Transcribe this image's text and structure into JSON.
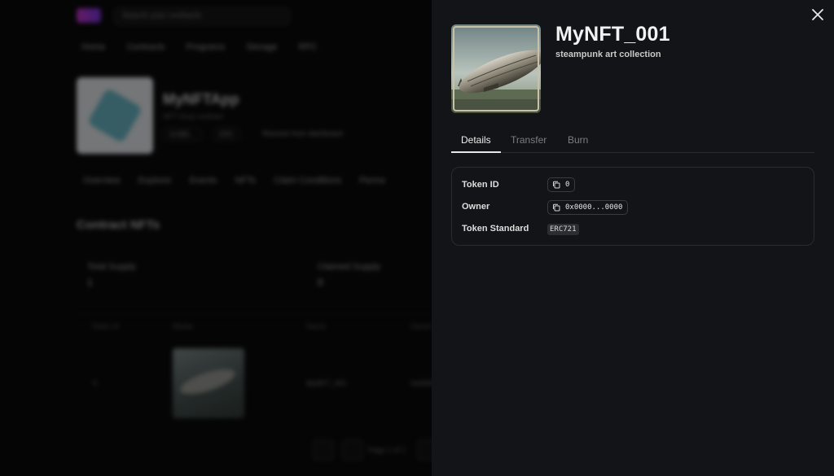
{
  "background": {
    "search_placeholder": "Search your contracts",
    "nav": [
      "Home",
      "Contracts",
      "Programs",
      "Storage",
      "RPC"
    ],
    "app_name": "MyNFTApp",
    "app_subtitle": "NFT Drop contract",
    "chips": [
      "0x0B5...",
      "ERC"
    ],
    "chip_import": "Remove from dashboard",
    "tabs": [
      "Overview",
      "Explorer",
      "Events",
      "NFTs",
      "Claim Conditions",
      "Perms"
    ],
    "section_title": "Contract NFTs",
    "stats": [
      {
        "label": "Total Supply",
        "value": "1"
      },
      {
        "label": "Claimed Supply",
        "value": "0"
      }
    ],
    "columns": [
      "Token Id",
      "Media",
      "Name",
      "Owner"
    ],
    "row": {
      "token_id": "0",
      "name": "MyNFT_001",
      "owner": "0x0000"
    },
    "pagination_text": "Page 1 of 1"
  },
  "drawer": {
    "title": "MyNFT_001",
    "subtitle": "steampunk art collection",
    "tabs": [
      {
        "label": "Details",
        "active": true
      },
      {
        "label": "Transfer",
        "active": false
      },
      {
        "label": "Burn",
        "active": false
      }
    ],
    "details": {
      "token_id_label": "Token ID",
      "token_id_value": "0",
      "owner_label": "Owner",
      "owner_value": "0x0000...0000",
      "standard_label": "Token Standard",
      "standard_value": "ERC721"
    },
    "icons": {
      "close": "close-icon",
      "copy": "copy-icon"
    },
    "colors": {
      "panel": "#131417",
      "accent_logo": "#b42fb8"
    }
  }
}
